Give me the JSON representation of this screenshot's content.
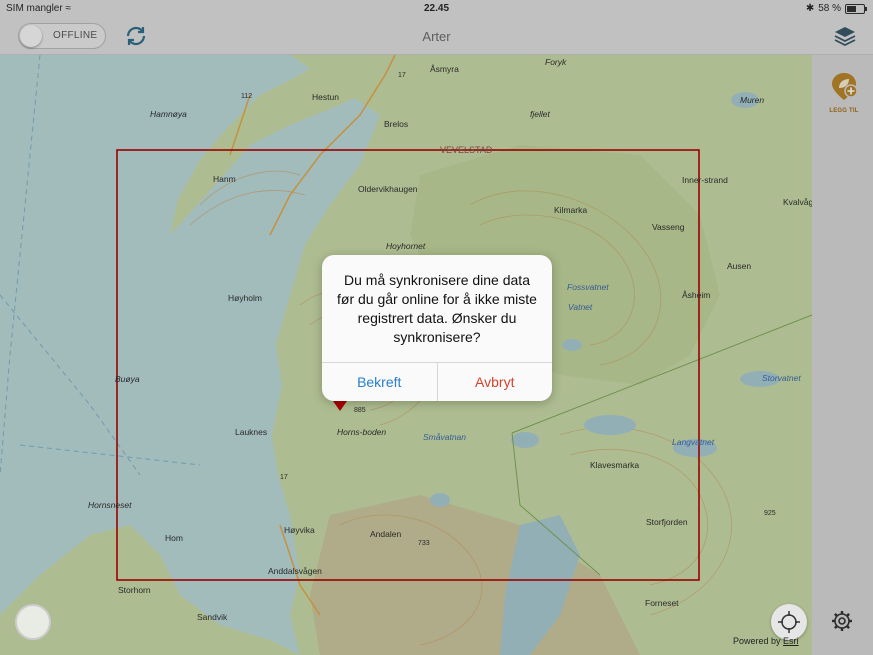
{
  "status_bar": {
    "carrier": "SIM mangler",
    "time": "22.45",
    "battery": "58 %",
    "battery_level": 0.58
  },
  "nav": {
    "toggle_label": "OFFLINE",
    "title": "Arter"
  },
  "sidebar": {
    "add_label": "LEGG TIL"
  },
  "map": {
    "labels": [
      "Hamnøya",
      "Hestun",
      "Åsmyra",
      "Foryk",
      "Brelos",
      "fjellet",
      "Muren",
      "Hanm",
      "VEVELSTAD",
      "Oldervikhaugen",
      "Kilmarka",
      "Inner-strand",
      "Kvalvåg",
      "Vasseng",
      "Høyholm",
      "Hoyhornet",
      "Ausen",
      "Fossvatnet",
      "Buøya",
      "Vatnet",
      "Åsheim",
      "Storvatnet",
      "Lauknes",
      "Horns-boden",
      "Småvatnan",
      "Langvatnet",
      "Klavesmarka",
      "Hornsneset",
      "Hom",
      "Høyvika",
      "Andalen",
      "Storfjorden",
      "Anddalsvågen",
      "Storhorn",
      "Sandvik",
      "Forneset"
    ],
    "road_numbers": [
      "112",
      "17",
      "17"
    ],
    "spot_heights": [
      "885",
      "733",
      "925"
    ]
  },
  "map_footer": {
    "powered_by": "Powered by",
    "esri": "Esri"
  },
  "dialog": {
    "message": "Du må synkronisere dine data før du går online for å ikke miste registrert data. Ønsker du synkronisere?",
    "confirm": "Bekreft",
    "cancel": "Avbryt"
  },
  "colors": {
    "accent_blue": "#2a7fc8",
    "cancel_red": "#d2442f",
    "study_area_border": "#b00000",
    "add_gold": "#b7852a"
  }
}
